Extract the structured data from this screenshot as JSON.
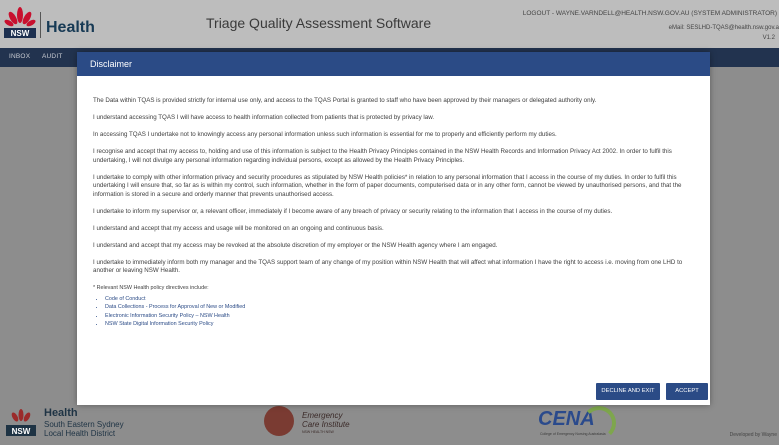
{
  "header": {
    "logo_text": "NSW",
    "health_label": "Health",
    "app_title": "Triage Quality Assessment Software",
    "user_line": "LOGOUT - WAYNE.VARNDELL@HEALTH.NSW.GOV.AU (SYSTEM ADMINISTRATOR)",
    "email_line": "eMail: SESLHD-TQAS@health.nsw.gov.a",
    "version": "V1.2"
  },
  "nav": {
    "items": [
      "INBOX",
      "AUDIT"
    ]
  },
  "modal": {
    "title": "Disclaimer",
    "paragraphs": [
      "The Data within TQAS is provided strictly for internal use only, and access to the TQAS Portal is granted to staff who have been approved by their managers or delegated authority only.",
      "I understand accessing TQAS I will have access to health information collected from patients that is protected by privacy law.",
      "In accessing TQAS I undertake not to knowingly access any personal information unless such information is essential for me to properly and efficiently perform my duties.",
      "I recognise and accept that my access to, holding and use of this information is subject to the Health Privacy Principles contained in the NSW Health Records and Information Privacy Act 2002. In order to fulfil this undertaking, I will not divulge any personal information regarding individual persons, except as allowed by the Health Privacy Principles.",
      "I undertake to comply with other information privacy and security procedures as stipulated by NSW Health policies* in relation to any personal information that I access in the course of my duties. In order to fulfil this undertaking I will ensure that, so far as is within my control, such information, whether in the form of paper documents, computerised data or in any other form, cannot be viewed by unauthorised persons, and that the information is stored in a secure and orderly manner that prevents unauthorised access.",
      "I undertake to inform my supervisor or, a relevant officer, immediately if I become aware of any breach of privacy or security relating to the information that I access in the course of my duties.",
      "I understand and accept that my access and usage will be monitored on an ongoing and continuous basis.",
      "I understand and accept that my access may be revoked at the absolute discretion of my employer or the NSW Health agency where I am engaged.",
      "I undertake to immediately inform both my manager and the TQAS support team of any change of my position within NSW Health that will affect what information I have the right to access i.e. moving from one LHD to another or leaving NSW Health."
    ],
    "policy_note": "* Relevant NSW Health policy directives include:",
    "policy_links": [
      "Code of Conduct",
      "Data Collections - Process for Approval of New or Modified",
      "Electronic Information Security Policy – NSW Health",
      "NSW State Digital Information Security Policy"
    ],
    "decline_label": "DECLINE AND EXIT",
    "accept_label": "ACCEPT"
  },
  "footer": {
    "nsw_text": "NSW",
    "health_label": "Health",
    "district_line1": "South Eastern Sydney",
    "district_line2": "Local Health District",
    "eci_line1": "Emergency",
    "eci_line2": "Care Institute",
    "eci_line3": "NSW HEALTH NSW",
    "cena_label": "CENA",
    "cena_sub": "College of Emergency Nursing Australasia",
    "developed_by": "Developed by Wayne"
  },
  "colors": {
    "brand_blue": "#2b4b86",
    "nav_bg": "#22334f",
    "overlay": "#8d8d8d"
  }
}
